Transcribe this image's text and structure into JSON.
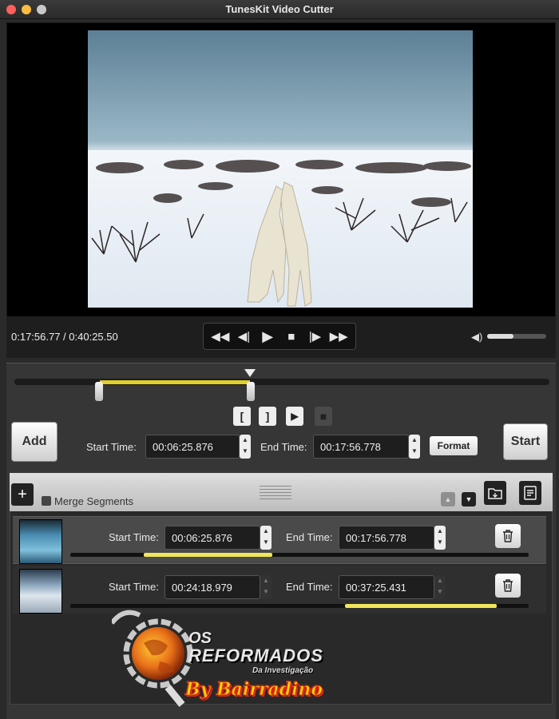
{
  "window": {
    "title": "TunesKit Video Cutter"
  },
  "player": {
    "time_display": "0:17:56.77 / 0:40:25.50",
    "volume": 0.45
  },
  "trim": {
    "start_label": "Start Time:",
    "start_value": "00:06:25.876",
    "end_label": "End Time:",
    "end_value": "00:17:56.778",
    "add_label": "Add",
    "start_button": "Start",
    "format_button": "Format",
    "selection_start": 0.16,
    "selection_end": 0.44,
    "playhead": 0.44
  },
  "segments_panel": {
    "merge_label": "Merge Segments",
    "segments": [
      {
        "start_label": "Start Time:",
        "start_value": "00:06:25.876",
        "end_label": "End Time:",
        "end_value": "00:17:56.778",
        "range": [
          0.16,
          0.44
        ]
      },
      {
        "start_label": "Start Time:",
        "start_value": "00:24:18.979",
        "end_label": "End Time:",
        "end_value": "00:37:25.431",
        "range": [
          0.6,
          0.93
        ]
      }
    ]
  },
  "watermark": {
    "brand_line1": "OS",
    "brand_line2": "REFORMADOS",
    "brand_line3": "Da Investigação",
    "signature": "By Bairradino"
  },
  "colors": {
    "selection": "#e0cf2a",
    "segment_fill": "#f0e65a",
    "watermark_red": "#d8261c",
    "watermark_yellow": "#f5d800"
  }
}
